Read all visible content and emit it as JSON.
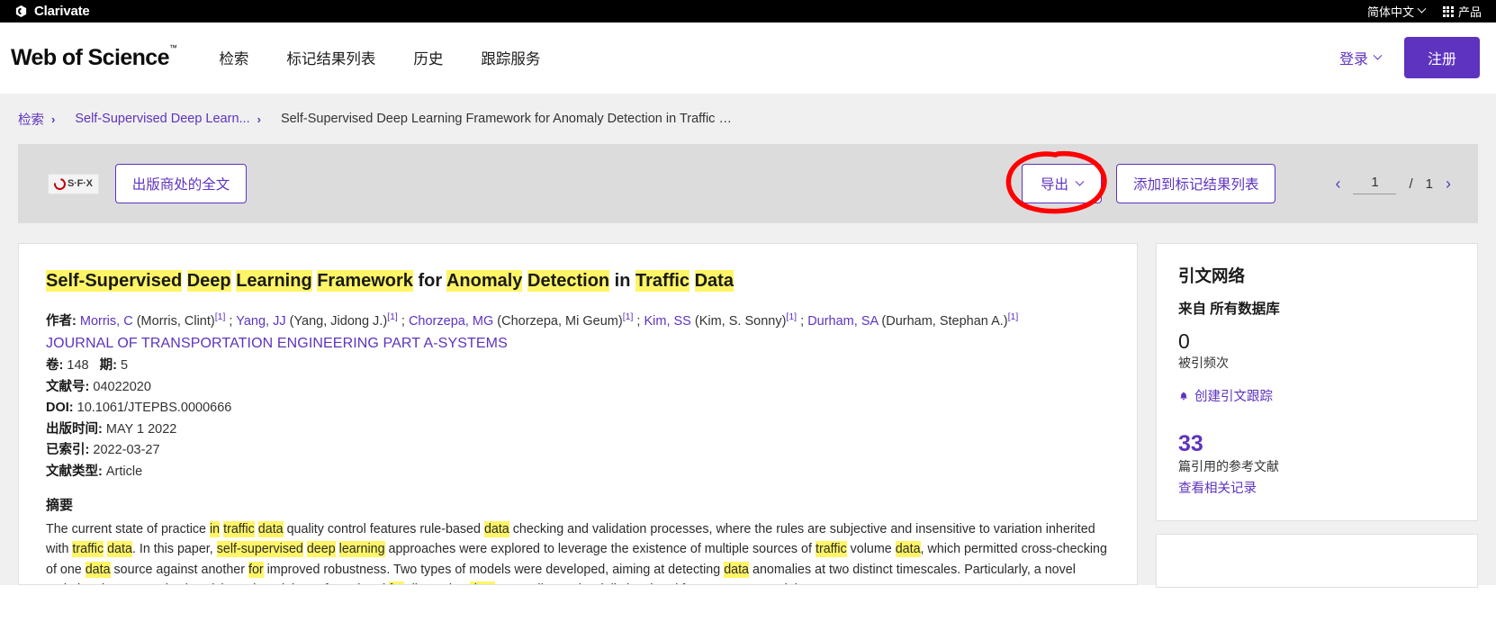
{
  "clarivate_bar": {
    "brand": "Clarivate",
    "language": "简体中文",
    "products": "产品",
    "logo_icon": "clarivate-logo-mark",
    "chevron_icon": "chevron-down-icon",
    "grid_icon": "app-grid-icon"
  },
  "header": {
    "logo": "Web of Science",
    "logo_tm": "™",
    "nav": [
      {
        "label": "检索"
      },
      {
        "label": "标记结果列表"
      },
      {
        "label": "历史"
      },
      {
        "label": "跟踪服务"
      }
    ],
    "sign_in": "登录",
    "register": "注册",
    "accent": "#5e33bf"
  },
  "breadcrumb": {
    "items": [
      {
        "label": "检索",
        "type": "link"
      },
      {
        "label": "Self-Supervised Deep Learn...",
        "type": "link"
      },
      {
        "label": "Self-Supervised Deep Learning Framework for Anomaly Detection in Traffic …",
        "type": "current"
      }
    ],
    "separator": "›"
  },
  "toolbar": {
    "sfx_label": "S·F·X",
    "sfx_icon": "sfx-logo-icon",
    "full_text_label": "出版商处的全文",
    "export_label": "导出",
    "export_chevron_icon": "chevron-down-icon",
    "add_to_marked_label": "添加到标记结果列表",
    "annotation": {
      "shape": "hand-drawn-ellipse",
      "color": "#ff0000",
      "target": "export-button"
    },
    "pagination": {
      "prev_icon": "chevron-left-icon",
      "next_icon": "chevron-right-icon",
      "current": "1",
      "separator": "/",
      "total": "1"
    }
  },
  "record": {
    "title_parts": [
      {
        "t": "Self-Supervised",
        "hl": true
      },
      {
        "t": " ",
        "hl": false
      },
      {
        "t": "Deep",
        "hl": true
      },
      {
        "t": " ",
        "hl": false
      },
      {
        "t": "Learning",
        "hl": true
      },
      {
        "t": " ",
        "hl": false
      },
      {
        "t": "Framework",
        "hl": true
      },
      {
        "t": " for ",
        "hl": false
      },
      {
        "t": "Anomaly",
        "hl": true
      },
      {
        "t": " ",
        "hl": false
      },
      {
        "t": "Detection",
        "hl": true
      },
      {
        "t": " in ",
        "hl": false
      },
      {
        "t": "Traffic",
        "hl": true
      },
      {
        "t": " ",
        "hl": false
      },
      {
        "t": "Data",
        "hl": true
      }
    ],
    "title_plain": "Self-Supervised Deep Learning Framework for Anomaly Detection in Traffic Data",
    "authors_label": "作者:",
    "authors": [
      {
        "link": "Morris, C",
        "rest": " (Morris, Clint)",
        "ref": "[1]"
      },
      {
        "link": "Yang, JJ",
        "rest": " (Yang, Jidong J.)",
        "ref": "[1]"
      },
      {
        "link": "Chorzepa, MG",
        "rest": " (Chorzepa, Mi Geum)",
        "ref": "[1]"
      },
      {
        "link": "Kim, SS",
        "rest": " (Kim, S. Sonny)",
        "ref": "[1]"
      },
      {
        "link": "Durham, SA",
        "rest": " (Durham, Stephan A.)",
        "ref": "[1]"
      }
    ],
    "author_separator": ";",
    "journal": "JOURNAL OF TRANSPORTATION ENGINEERING PART A-SYSTEMS",
    "fields": [
      {
        "label": "卷:",
        "value": "148",
        "label2": "期:",
        "value2": "5"
      },
      {
        "label": "文献号:",
        "value": "04022020"
      },
      {
        "label": "DOI:",
        "value": "10.1061/JTEPBS.0000666"
      },
      {
        "label": "出版时间:",
        "value": "MAY 1 2022"
      },
      {
        "label": "已索引:",
        "value": "2022-03-27"
      },
      {
        "label": "文献类型:",
        "value": "Article"
      }
    ],
    "abstract_heading": "摘要",
    "abstract_parts": [
      {
        "t": "The current state of practice ",
        "hl": false
      },
      {
        "t": "in",
        "hl": true
      },
      {
        "t": " ",
        "hl": false
      },
      {
        "t": "traffic",
        "hl": true
      },
      {
        "t": " ",
        "hl": false
      },
      {
        "t": "data",
        "hl": true
      },
      {
        "t": " quality control features rule-based ",
        "hl": false
      },
      {
        "t": "data",
        "hl": true
      },
      {
        "t": " checking and validation processes, where the rules are subjective and insensitive to variation inherited with ",
        "hl": false
      },
      {
        "t": "traffic",
        "hl": true
      },
      {
        "t": " ",
        "hl": false
      },
      {
        "t": "data",
        "hl": true
      },
      {
        "t": ". In this paper, ",
        "hl": false
      },
      {
        "t": "self-supervised",
        "hl": true
      },
      {
        "t": " ",
        "hl": false
      },
      {
        "t": "deep",
        "hl": true
      },
      {
        "t": " ",
        "hl": false
      },
      {
        "t": "learning",
        "hl": true
      },
      {
        "t": " approaches were explored to leverage the existence of multiple sources of ",
        "hl": false
      },
      {
        "t": "traffic",
        "hl": true
      },
      {
        "t": " volume ",
        "hl": false
      },
      {
        "t": "data",
        "hl": true
      },
      {
        "t": ", which permitted cross-checking of one ",
        "hl": false
      },
      {
        "t": "data",
        "hl": true
      },
      {
        "t": " source against another ",
        "hl": false
      },
      {
        "t": "for",
        "hl": true
      },
      {
        "t": " improved robustness. Two types of models were developed, aiming at detecting ",
        "hl": false
      },
      {
        "t": "data",
        "hl": true
      },
      {
        "t": " anomalies at two distinct timescales. Particularly, a novel variational autoencoder (VAE)-based model was formulated ",
        "hl": false
      },
      {
        "t": "for",
        "hl": true
      },
      {
        "t": " discerning ",
        "hl": false
      },
      {
        "t": "data",
        "hl": true
      },
      {
        "t": " anomalies at the daily level and four recurrent model structures,",
        "hl": false
      }
    ]
  },
  "sidebar": {
    "citation_network": {
      "title": "引文网络",
      "source_label": "来自 所有数据库",
      "times_cited_count": "0",
      "times_cited_label": "被引频次",
      "create_alert_label": "创建引文跟踪",
      "bell_icon": "bell-icon",
      "references_count": "33",
      "references_label": "篇引用的参考文献",
      "see_related_label": "查看相关记录"
    }
  }
}
